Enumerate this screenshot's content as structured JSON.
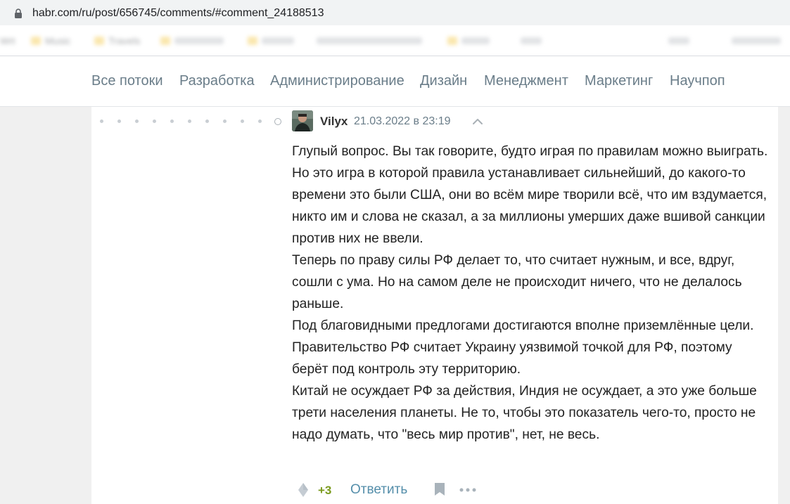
{
  "browser": {
    "url": "habr.com/ru/post/656745/comments/#comment_24188513",
    "bookmarks": [
      "Wrt",
      "Music",
      "Travels"
    ]
  },
  "nav": {
    "items": [
      "Все потоки",
      "Разработка",
      "Администрирование",
      "Дизайн",
      "Менеджмент",
      "Маркетинг",
      "Научпоп"
    ]
  },
  "comment": {
    "author": "Vilyx",
    "datetime": "21.03.2022 в 23:19",
    "paragraphs": [
      "Глупый вопрос. Вы так говорите, будто играя по правилам можно выиграть. Но это игра в которой правила устанавливает сильнейший, до какого-то времени это были США, они во всём мире творили всё, что им вздумается, никто им и слова не сказал, а за миллионы умерших даже вшивой санкции против них не ввели.",
      "Теперь по праву силы РФ делает то, что считает нужным, и все, вдруг, сошли с ума. Но на самом деле не происходит ничего, что не делалось раньше.",
      "Под благовидными предлогами достигаются вполне приземлённые цели. Правительство РФ считает Украину уязвимой точкой для РФ, поэтому берёт под контроль эту территорию.",
      "Китай не осуждает РФ за действия, Индия не осуждает, а это уже больше трети населения планеты. Не то, чтобы это показатель чего-то, просто не надо думать, что \"весь мир против\", нет, не весь."
    ],
    "score": "+3",
    "reply_label": "Ответить"
  },
  "colors": {
    "nav_text": "#6a7d89",
    "score": "#7b9b1f",
    "reply_link": "#548eaa"
  },
  "icons": {
    "lock": "lock-icon",
    "collapse": "chevron-up-icon",
    "vote": "vote-icon",
    "bookmark": "bookmark-icon",
    "more": "more-icon"
  }
}
